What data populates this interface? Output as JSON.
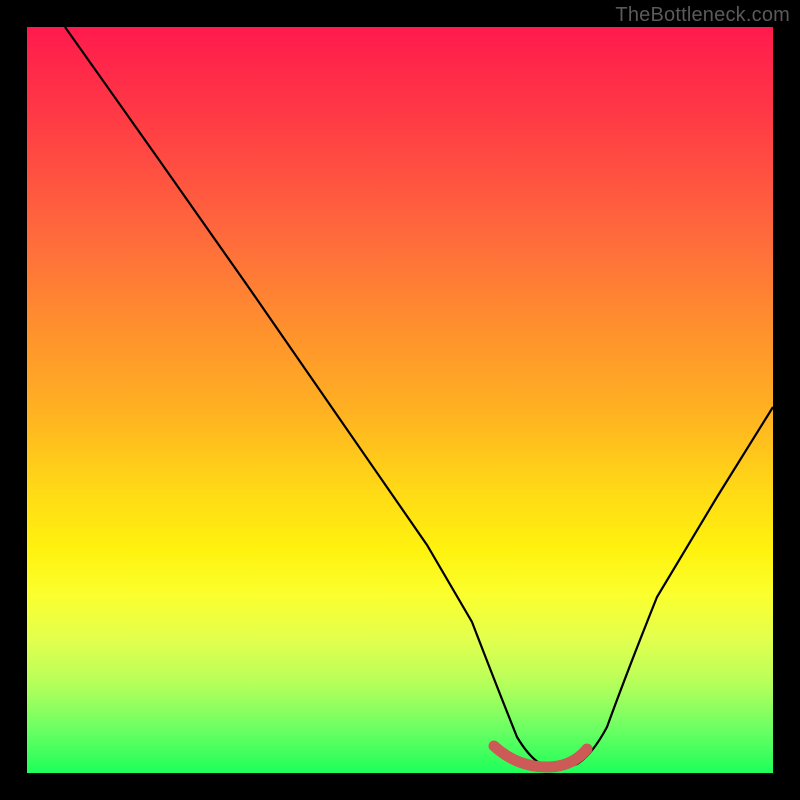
{
  "attribution": "TheBottleneck.com",
  "colors": {
    "frame": "#000000",
    "curve": "#000000",
    "marker": "#cc5a57",
    "gradient_top": "#ff1a4d",
    "gradient_bottom": "#1dff5a"
  },
  "chart_data": {
    "type": "line",
    "title": "",
    "xlabel": "",
    "ylabel": "",
    "xlim": [
      0,
      100
    ],
    "ylim": [
      0,
      100
    ],
    "x": [
      5,
      10,
      15,
      20,
      25,
      30,
      35,
      40,
      45,
      50,
      55,
      60,
      62,
      65,
      70,
      72,
      75,
      80,
      85,
      90,
      95,
      100
    ],
    "values": [
      100,
      92,
      84,
      75,
      67,
      58,
      50,
      41,
      33,
      24,
      16,
      7,
      4,
      1,
      0,
      0,
      2,
      10,
      20,
      31,
      42,
      53
    ],
    "annotations": [
      {
        "label": "optimal-range",
        "x_start": 62,
        "x_end": 72,
        "y": 0
      }
    ]
  }
}
